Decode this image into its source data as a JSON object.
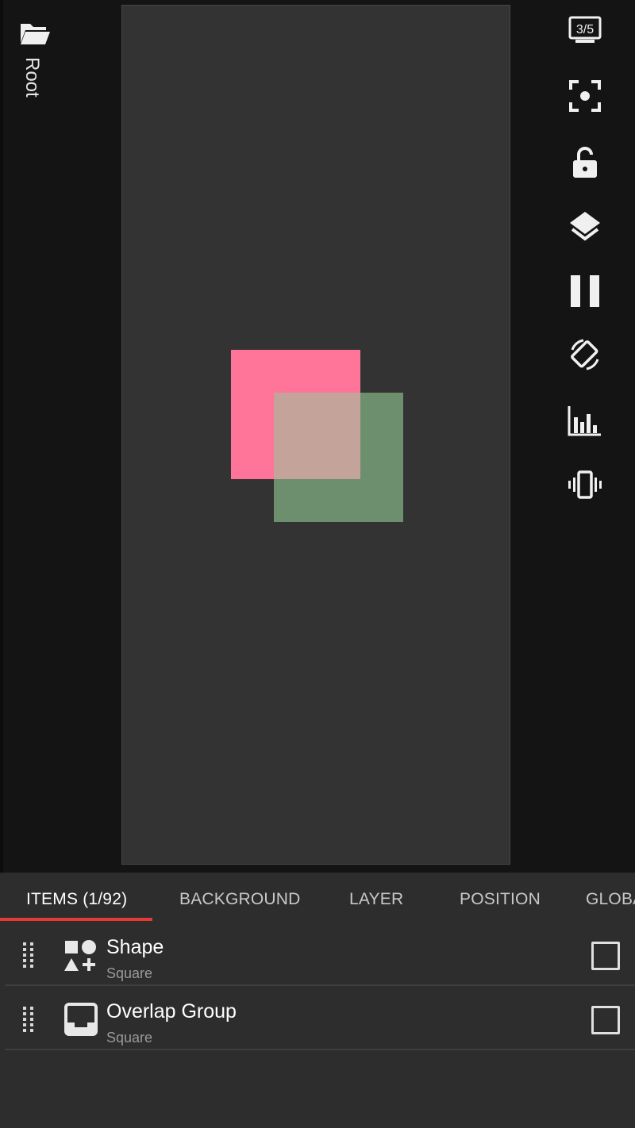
{
  "workspace": {
    "root_label": "Root",
    "colors": {
      "background": "#141414",
      "canvas": "#333333",
      "pink_square": "#ff7499",
      "green_square": "#78a078",
      "overlap": "#c4a39a"
    }
  },
  "toolbar": {
    "page_counter": "3/5",
    "icons": [
      "monitor-page-icon",
      "focus-icon",
      "lock-icon",
      "layers-icon",
      "pause-icon",
      "rotate-screen-icon",
      "chart-icon",
      "vibrate-icon"
    ]
  },
  "tabs": [
    {
      "label": "ITEMS (1/92)",
      "active": true
    },
    {
      "label": "BACKGROUND"
    },
    {
      "label": "LAYER"
    },
    {
      "label": "POSITION"
    },
    {
      "label": "GLOBA"
    }
  ],
  "accent": "#e53935",
  "items": [
    {
      "title": "Shape",
      "subtitle": "Square",
      "icon": "shapes-icon"
    },
    {
      "title": "Overlap Group",
      "subtitle": "Square",
      "icon": "inbox-icon"
    }
  ]
}
